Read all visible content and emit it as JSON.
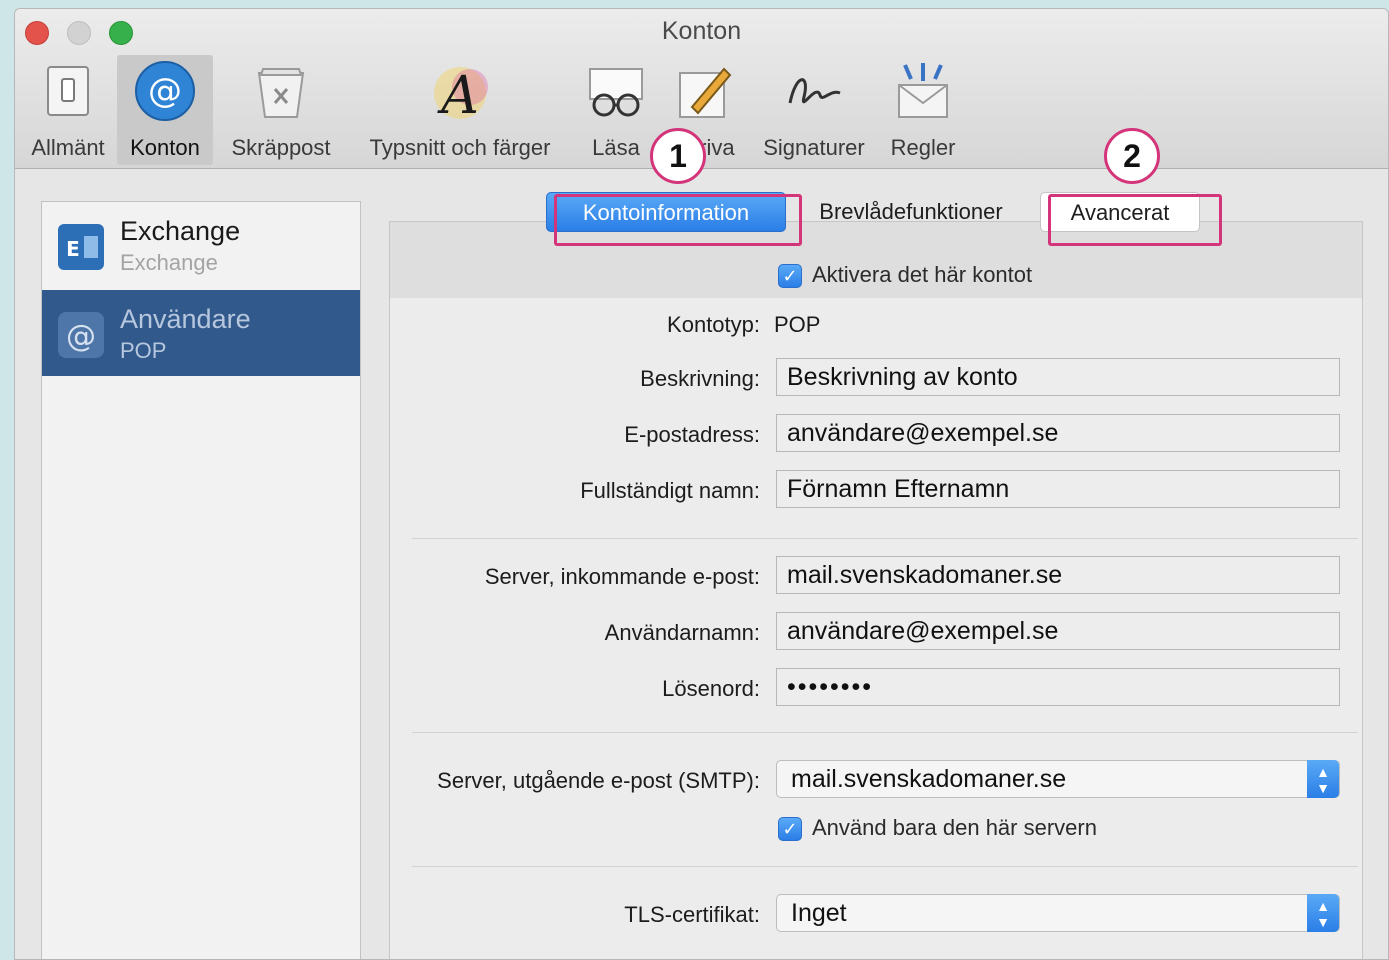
{
  "window": {
    "title": "Konton"
  },
  "toolbar": {
    "items": [
      {
        "label": "Allmänt",
        "icon": "switch-icon"
      },
      {
        "label": "Konton",
        "icon": "at-icon"
      },
      {
        "label": "Skräppost",
        "icon": "junk-bin-icon"
      },
      {
        "label": "Typsnitt och färger",
        "icon": "font-a-icon"
      },
      {
        "label": "Läsa",
        "icon": "glasses-icon"
      },
      {
        "label": "Skriva",
        "icon": "pencil-icon"
      },
      {
        "label": "Signaturer",
        "icon": "signature-icon"
      },
      {
        "label": "Regler",
        "icon": "rules-envelope-icon"
      }
    ]
  },
  "sidebar": {
    "accounts": [
      {
        "name": "Exchange",
        "type": "Exchange",
        "icon": "exchange-icon"
      },
      {
        "name": "Användare",
        "type": "POP",
        "icon": "at-icon"
      }
    ]
  },
  "tabs": {
    "info": "Kontoinformation",
    "mailbox": "Brevlådefunktioner",
    "advanced": "Avancerat"
  },
  "annotations": {
    "badge1": "1",
    "badge2": "2",
    "color": "#d4357a"
  },
  "form": {
    "enable_label": "Aktivera det här kontot",
    "account_type_label": "Kontotyp:",
    "account_type_value": "POP",
    "description_label": "Beskrivning:",
    "description_value": "Beskrivning av konto",
    "email_label": "E-postadress:",
    "email_value": "användare@exempel.se",
    "fullname_label": "Fullständigt namn:",
    "fullname_value": "Förnamn Efternamn",
    "incoming_label": "Server, inkommande e-post:",
    "incoming_value": "mail.svenskadomaner.se",
    "username_label": "Användarnamn:",
    "username_value": "användare@exempel.se",
    "password_label": "Lösenord:",
    "password_value": "••••••••",
    "smtp_label": "Server, utgående e-post (SMTP):",
    "smtp_value": "mail.svenskadomaner.se",
    "only_server_label": "Använd bara den här servern",
    "tls_label": "TLS-certifikat:",
    "tls_value": "Inget"
  },
  "colors": {
    "accent": "#2a7ee6",
    "selection": "#32598c"
  }
}
